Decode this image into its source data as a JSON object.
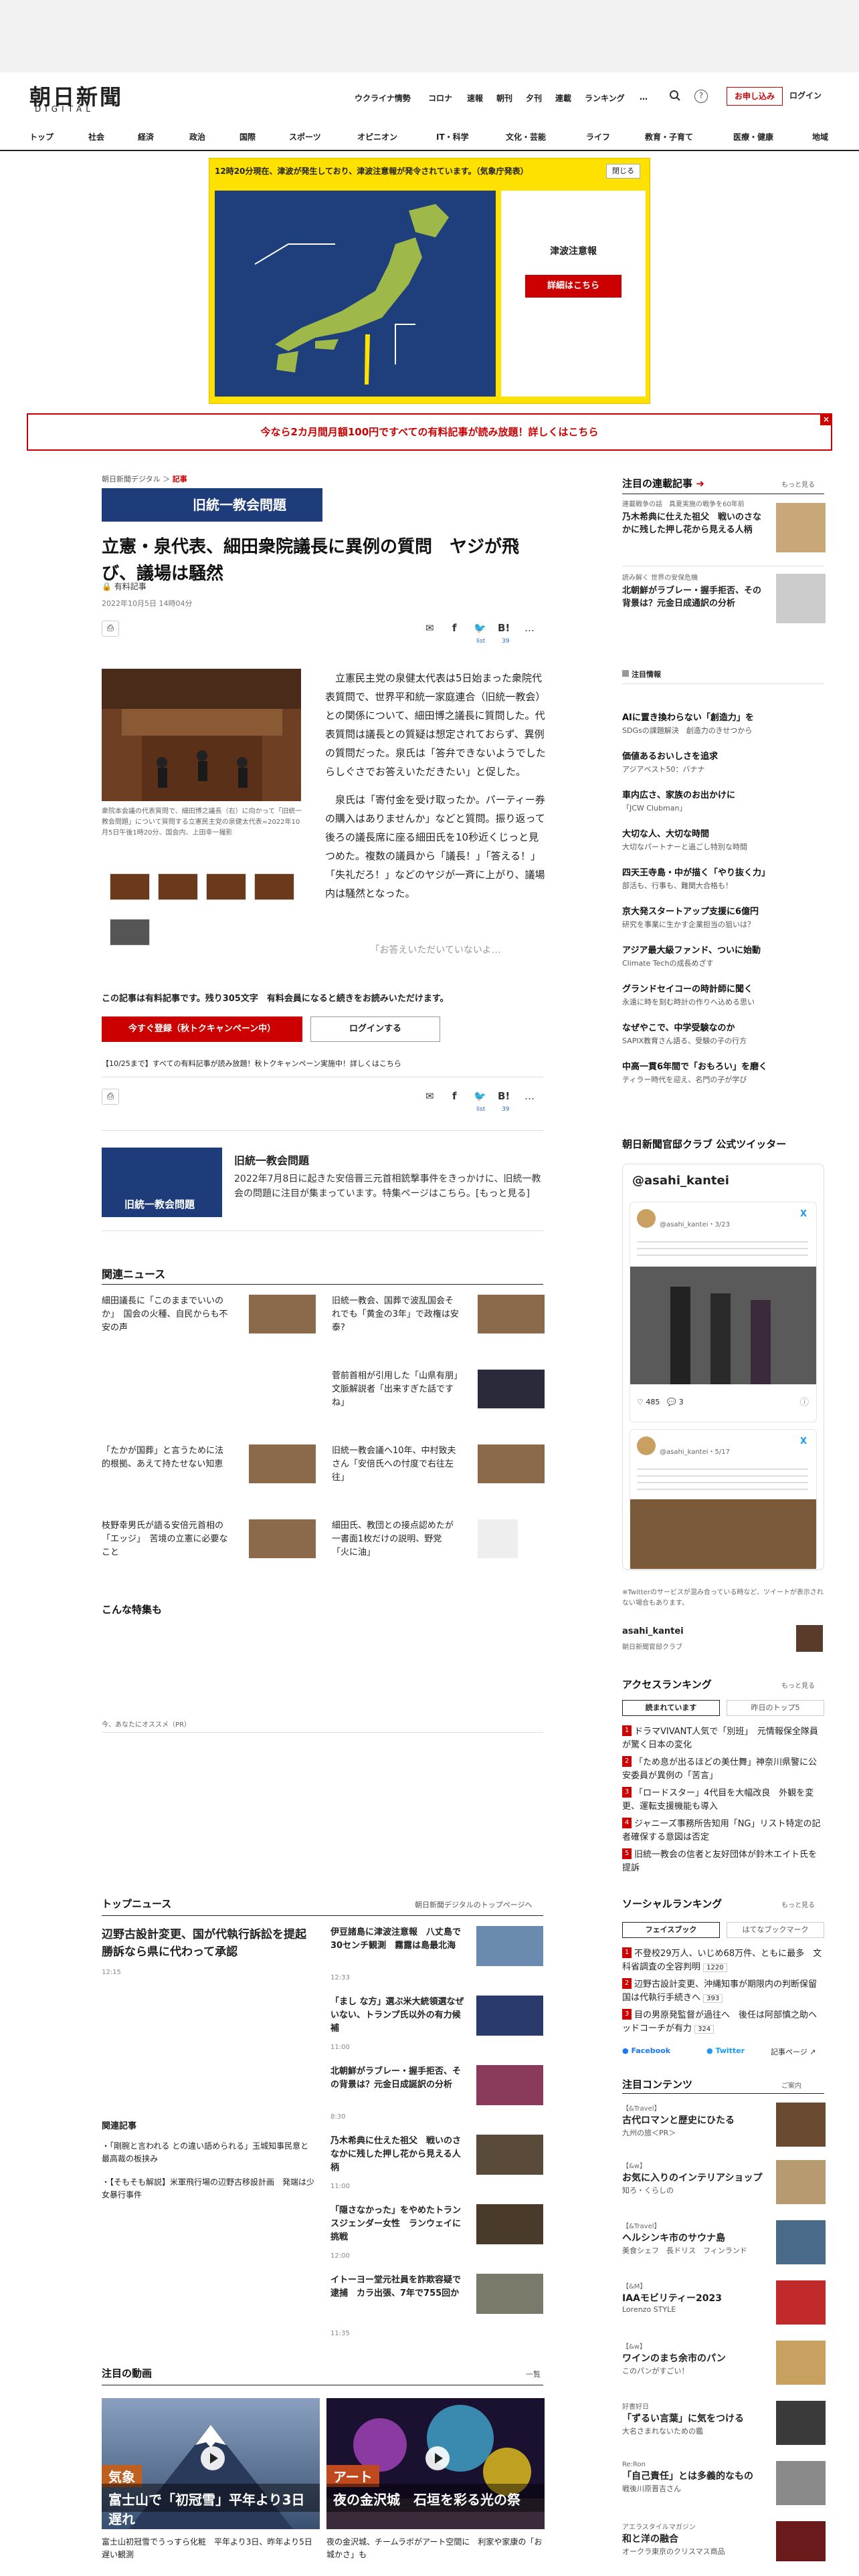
{
  "header": {
    "logo_jp": "朝日新聞",
    "logo_en": "DIGITAL",
    "nav": [
      "ウクライナ情勢",
      "コロナ",
      "速報",
      "朝刊",
      "夕刊",
      "連載",
      "ランキング",
      "…"
    ],
    "subscribe": "お申し込み",
    "login": "ログイン",
    "categories": [
      "トップ",
      "社会",
      "経済",
      "政治",
      "国際",
      "スポーツ",
      "オピニオン",
      "IT・科学",
      "文化・芸能",
      "ライフ",
      "教育・子育て",
      "医療・健康",
      "地域"
    ]
  },
  "alert": {
    "text": "12時20分現在、津波が発生しており、津波注意報が発令されています。（気象庁発表）",
    "close": "閉じる",
    "title": "津波注意報",
    "button": "詳細はこちら"
  },
  "promo": {
    "text": "今なら2カ月間月額100円ですべての有料記事が読み放題！詳しくはこちら",
    "close": "×"
  },
  "article": {
    "breadcrumb": [
      "朝日新聞デジタル",
      "記事"
    ],
    "series": "旧統一教会問題",
    "headline": "立憲・泉代表、細田衆院議長に異例の質問　ヤジが飛び、議場は騒然",
    "paid_label": "有料記事",
    "date": "2022年10月5日 14時04分",
    "share_list": "list",
    "share_count": "39",
    "photo_caption": "衆院本会議の代表質問で、細田博之議長（右）に向かって「旧統一教会問題」について質問する立憲民主党の泉健太代表=2022年10月5日午後1時20分、国会内、上田幸一撮影",
    "paragraph1": "立憲民主党の泉健太代表は5日始まった衆院代表質問で、世界平和統一家庭連合（旧統一教会）との関係について、細田博之議長に質問した。代表質問は議長との質疑は想定されておらず、異例の質問だった。泉氏は「答弁できないようでしたらしぐさでお答えいただきたい」と促した。",
    "paragraph2": "泉氏は「寄付金を受け取ったか。パーティー券の購入はありませんか」などと質問。振り返って後ろの議長席に座る細田氏を10秒近くじっと見つめた。複数の議員から「議長！」「答える！」「失礼だろ！」などのヤジが一斉に上がり、議場内は騒然となった。",
    "fade_text": "「お答えいただいていないよ…",
    "paywall_text": "この記事は有料記事です。残り305文字　有料会員になると続きをお読みいただけます。",
    "register_button": "今すぐ登録（秋トクキャンペーン中）",
    "login_button": "ログインする",
    "campaign_text": "【10/25まで】すべての有料記事が読み放題！秋トクキャンペーン実施中！詳しくはこちら"
  },
  "feature": {
    "image_text": "旧統一教会問題",
    "title": "旧統一教会問題",
    "desc": "2022年7月8日に起きた安倍晋三元首相銃撃事件をきっかけに、旧統一教会の問題に注目が集まっています。特集ページはこちら。[もっと見る]"
  },
  "related": {
    "heading": "関連ニュース",
    "items": [
      "細田議長に「このままでいいのか」　国会の火種、自民からも不安の声",
      "旧統一教会、国葬で波乱国会それでも「黄金の3年」で政権は安泰?",
      "",
      "菅前首相が引用した「山県有朋」　文脈解説者「出来すぎた話ですね」",
      "「たかが国葬」と言うために法的根拠、あえて持たせない知恵",
      "旧統一教会議へ10年、中村致夫さん「安倍氏への忖度で右往左往」",
      "枝野幸男氏が語る安倍元首相の「エッジ」　苦境の立憲に必要なこと",
      "細田氏、教団との接点認めたが一書面1枚だけの説明、野党「火に油」"
    ]
  },
  "special": {
    "heading": "こんな特集も",
    "recommend": "今、あなたにオススメ（PR）"
  },
  "top_news": {
    "heading": "トップニュース",
    "more": "朝日新聞デジタルのトップページへ",
    "lead_title": "辺野古設計変更、国が代執行訴訟を提起　勝訴なら県に代わって承認",
    "lead_time": "12:15",
    "items": [
      {
        "title": "伊豆諸島に津波注意報　八丈島で30センチ観測　霧露は島最北海",
        "time": "12:33"
      },
      {
        "title": "「まし な方」選ぶ米大統領選なぜいない、トランプ氏以外の有力候補",
        "time": "11:00"
      },
      {
        "title": "北朝鮮がラブレー・握手拒否、その背景は？元金日成誕訳の分析",
        "time": "8:30"
      },
      {
        "title": "乃木希典に仕えた祖父　戦いのさなかに残した押し花から見える人柄",
        "time": "11:00"
      },
      {
        "title": "「隠さなかった」をやめたトランスジェンダー女性　ランウェイに挑戦",
        "time": "12:00"
      },
      {
        "title": "イトーヨー堂元社員を詐欺容疑で逮捕　カラ出張、7年で755回か",
        "time": "11:35"
      }
    ],
    "related_heading": "関連記事",
    "related_items": [
      "「剛腕と言われる との違い語められる」玉城知事民意と最高裁の板挟み",
      "【そもそも解説】米軍飛行場の辺野古移設計画　発端は少女暴行事件"
    ]
  },
  "videos": {
    "heading": "注目の動画",
    "more": "一覧",
    "items": [
      {
        "label": "気象",
        "caption": "富士山で「初冠雪」平年より3日遅れ",
        "desc": "富士山初冠雪でうっすら化粧　平年より3日、昨年より5日遅い観測"
      },
      {
        "label": "アート",
        "caption": "夜の金沢城　石垣を彩る光の祭",
        "desc": "夜の金沢城、チームラボがアート空間に　利家や家康の「お城かさ」も"
      }
    ]
  },
  "sidebar": {
    "series_heading": "注目の連載記事",
    "more": "もっと見る",
    "series": [
      {
        "tag": "連載戦争の話　真夏実施の戦争を60年前",
        "title": "乃木希典に仕えた祖父　戦いのさなかに残した押し花から見える人柄"
      },
      {
        "tag": "読み解く 世界の安保危機",
        "title": "北朝鮮がラブレー・握手拒否、その背景は？元金日成通訳の分析"
      }
    ],
    "special_heading": "注目情報",
    "special_items": [
      {
        "t": "AIに置き換わらない「創造力」を",
        "s": "SDGsの課題解決　創造力のきせつから"
      },
      {
        "t": "価値あるおいしさを追求",
        "s": "アジアベスト50：バナナ"
      },
      {
        "t": "車内広さ、家族のお出かけに",
        "s": "「JCW Clubman」"
      },
      {
        "t": "大切な人、大切な時間",
        "s": "大切なパートナーと過ごし特別な時間"
      },
      {
        "t": "四天王寺島・中が描く「やり抜く力」",
        "s": "部活も、行事も、難関大合格も！"
      },
      {
        "t": "京大発スタートアップ支援に6億円",
        "s": "研究を事業に生かす企業担当の狙いは？"
      },
      {
        "t": "アジア最大級ファンド、ついに始動",
        "s": "Climate Techの成長めざす"
      },
      {
        "t": "グランドセイコーの時計師に聞く",
        "s": "永遠に時を刻む時計の作りへ込める思い"
      },
      {
        "t": "なぜやこで、中学受験なのか",
        "s": "SAPIX教育さん語る、受験の子の行方"
      },
      {
        "t": "中高一貫6年間で「おもろい」を磨く",
        "s": "ティラー時代を迎え、名門の子が学び"
      }
    ],
    "twitter_heading": "朝日新聞官邸クラブ 公式ツイッター",
    "twitter_name": "@asahi_kantei",
    "tweet_user": "@asahi_kantei",
    "tweet_time1": "3/23",
    "tweet_time2": "5/17",
    "tweet_likes": "485",
    "tweet_replies": "3",
    "twitter_note": "※Twitterのサービスが混み合っている時など、ツイートが表示されない場合もあります。",
    "twitter_account": "asahi_kantei",
    "twitter_account_desc": "朝日新聞官邸クラブ",
    "ranking_heading": "アクセスランキング",
    "ranking_tabs": [
      "読まれています",
      "昨日のトップ5"
    ],
    "ranking": [
      "ドラマVIVANT人気で「別班」　元情報保全隊員が驚く日本の変化",
      "「ため息が出るほどの美仕舞」神奈川県警に公安委員が異例の「苦言」",
      "「ロードスター」4代目を大幅改良　外観を変更、運転支援機能も導入",
      "ジャニーズ事務所告知用「NG」リスト特定の記者確保する意図は否定",
      "旧統一教会の信者と友好団体が鈴木エイト氏を提訴"
    ],
    "social_heading": "ソーシャルランキング",
    "social_tabs": [
      "フェイスブック",
      "はてなブックマーク"
    ],
    "social": [
      {
        "t": "不登校29万人、いじめ68万件、ともに最多　文科省調査の全容判明",
        "c": "1220"
      },
      {
        "t": "辺野古設計変更、沖縄知事が期限内の判断保留　国は代執行手続きへ",
        "c": "393"
      },
      {
        "t": "目の男原発監督が過往へ　後任は阿部慎之助ヘッドコーチが有力",
        "c": "324"
      }
    ],
    "social_links": [
      "Facebook",
      "Twitter",
      "記事ページ"
    ],
    "contents_heading": "注目コンテンツ",
    "contents_more": "ご案内",
    "contents": [
      {
        "tag": "【&Travel】",
        "t": "古代ロマンと歴史にひたる",
        "s": "九州の旅＜PR＞"
      },
      {
        "tag": "【&w】",
        "t": "お気に入りのインテリアショップ",
        "s": "知ろ・くらしの"
      },
      {
        "tag": "【&Travel】",
        "t": "ヘルシンキ市のサウナ島",
        "s": "美食シェフ　長ドリス　フィンランド"
      },
      {
        "tag": "【&M】",
        "t": "IAAモビリティー2023",
        "s": "Lorenzo STYLE"
      },
      {
        "tag": "【&w】",
        "t": "ワインのまち余市のパン",
        "s": "このパンがすごい！"
      },
      {
        "tag": "好書好日",
        "t": "「ずるい言葉」に気をつける",
        "s": "大名さまれないための鑑"
      },
      {
        "tag": "Re:Ron",
        "t": "「自己責任」とは多義的なもの",
        "s": "戦後川原晋吉さん"
      },
      {
        "tag": "アエラスタイルマガジン",
        "t": "和と洋の融合",
        "s": "オークラ東京のクリスマス商品"
      }
    ]
  }
}
